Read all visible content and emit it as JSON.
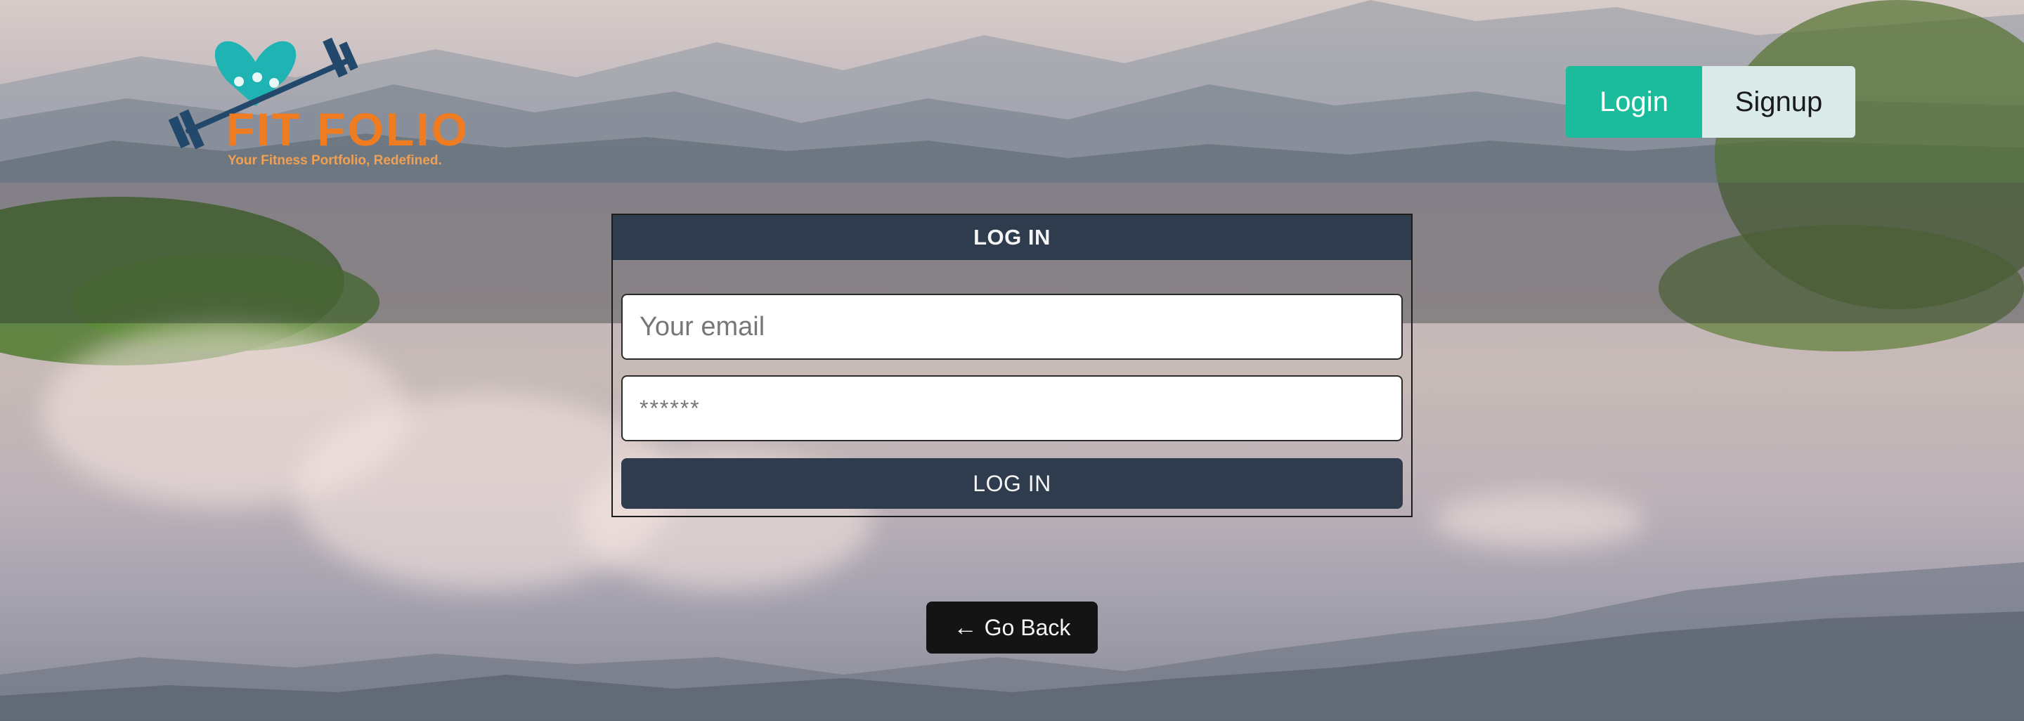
{
  "header": {
    "logo": {
      "title": "FIT FOLIO",
      "tagline": "Your Fitness Portfolio, Redefined.",
      "icon": "dumbbell-heart-logo"
    },
    "login_label": "Login",
    "signup_label": "Signup"
  },
  "login_card": {
    "title": "LOG IN",
    "email_placeholder": "Your email",
    "password_placeholder": "******",
    "submit_label": "LOG IN"
  },
  "back_button": {
    "icon": "left-arrow-icon",
    "arrow": "←",
    "label": "Go Back"
  },
  "colors": {
    "accent_teal": "#1abc9c",
    "signup_bg": "#d9eae9",
    "card_dark": "#2e3c4e",
    "logo_orange": "#f07c22",
    "logo_teal": "#1fb3b3",
    "logo_navy": "#22496b",
    "back_button_bg": "#141414"
  }
}
